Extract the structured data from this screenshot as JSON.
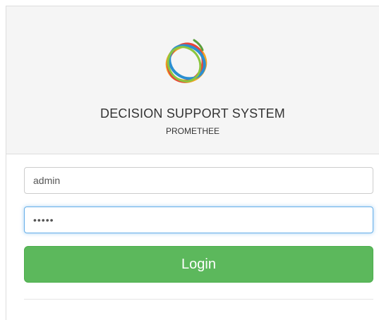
{
  "header": {
    "logo_icon": "swirl-ring-logo-icon",
    "title": "DECISION SUPPORT SYSTEM",
    "subtitle": "PROMETHEE"
  },
  "form": {
    "username_value": "admin",
    "password_value": "admin",
    "login_label": "Login"
  },
  "colors": {
    "heading_bg": "#f5f5f5",
    "button_bg": "#5cb85c",
    "focus_border": "#66afe9"
  }
}
